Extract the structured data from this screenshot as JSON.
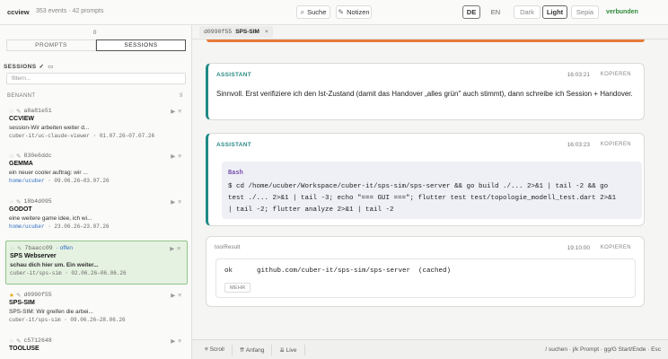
{
  "header": {
    "app_name": "ccview",
    "stats": "353 events · 42 prompts",
    "search_label": "Suche",
    "notes_label": "Notizen",
    "lang_de": "DE",
    "lang_en": "EN",
    "theme_dark": "Dark",
    "theme_light": "Light",
    "theme_sepia": "Sepia",
    "connection_status": "verbunden"
  },
  "sidebar": {
    "count": "0",
    "tab_prompts": "PROMPTS",
    "tab_sessions": "SESSIONS",
    "section_title": "SESSIONS",
    "section_mark": "✓",
    "filter_placeholder": "filtern...",
    "group_label": "BENANNT",
    "group_count": "9",
    "sessions": [
      {
        "star": false,
        "id": "a8a81e51",
        "status": "",
        "title": "CCVIEW",
        "preview": "session-Wir arbeiten weiter d...",
        "project": "cuber-it/uc-claude-viewer",
        "dates": "01.07.26–07.07.26",
        "project_blue": false
      },
      {
        "star": false,
        "id": "830e6ddc",
        "status": "",
        "title": "GEMMA",
        "preview": "ein neuer cooler auftrag: wir ...",
        "project": "home/ucuber",
        "dates": "09.06.26–03.07.26",
        "project_blue": true
      },
      {
        "star": false,
        "id": "18b4d095",
        "status": "",
        "title": "GODOT",
        "preview": "eine weitere game idee, ich wi...",
        "project": "home/ucuber",
        "dates": "23.06.26–23.07.26",
        "project_blue": true
      },
      {
        "star": false,
        "id": "7baacc09",
        "status": "· offen",
        "title": "SPS Webserver",
        "preview": "schau dich hier um. Ein weiter...",
        "project": "cuber-it/sps-sim",
        "dates": "02.06.26–06.06.26",
        "project_blue": false
      },
      {
        "star": true,
        "id": "d0990f55",
        "status": "",
        "title": "SPS-SIM",
        "preview": "SPS-SIM: Wir greifen die arbei...",
        "project": "cuber-it/sps-sim",
        "dates": "09.06.26–28.06.26",
        "project_blue": false
      },
      {
        "star": false,
        "id": "c5712648",
        "status": "",
        "title": "TOOLUSE",
        "preview": "",
        "project": "",
        "dates": "",
        "project_blue": false
      }
    ]
  },
  "main": {
    "tab_id": "d0990f55",
    "tab_name": "SPS-SIM",
    "tab_close": "×",
    "messages": [
      {
        "role": "ASSISTANT",
        "time": "16:03:21",
        "copy": "KOPIEREN",
        "text": "Sinnvoll. Erst verifiziere ich den Ist-Zustand (damit das Handover „alles grün\" auch stimmt), dann schreibe ich Session + Handover."
      },
      {
        "role": "ASSISTANT",
        "time": "16:03:23",
        "copy": "KOPIEREN",
        "tool_name": "Bash",
        "command": "$ cd /home/ucuber/Workspace/cuber-it/sps-sim/sps-server && go build ./... 2>&1 | tail -2 && go\ntest ./... 2>&1 | tail -3; echo \"=== GUI ===\"; flutter test test/topologie_modell_test.dart 2>&1\n| tail -2; flutter analyze 2>&1 | tail -2"
      },
      {
        "role": "toolResult",
        "time": "19:10:00",
        "copy": "KOPIEREN",
        "output": "ok      github.com/cuber-it/sps-sim/sps-server  (cached)",
        "more": "MEHR"
      }
    ]
  },
  "footer": {
    "scroll": "≡ Scroll",
    "start": "⇈ Anfang",
    "live": "⇊ Live",
    "hint": "/ suchen · j/k Prompt · gg/G Start/Ende · Esc"
  },
  "colors": {
    "accent_teal": "#1f8a86",
    "active_session_bg": "#e6f2e1",
    "connected_green": "#2f8a3a",
    "tool_name_purple": "#7a4fb0",
    "orange_rule": "#e87a3a"
  }
}
